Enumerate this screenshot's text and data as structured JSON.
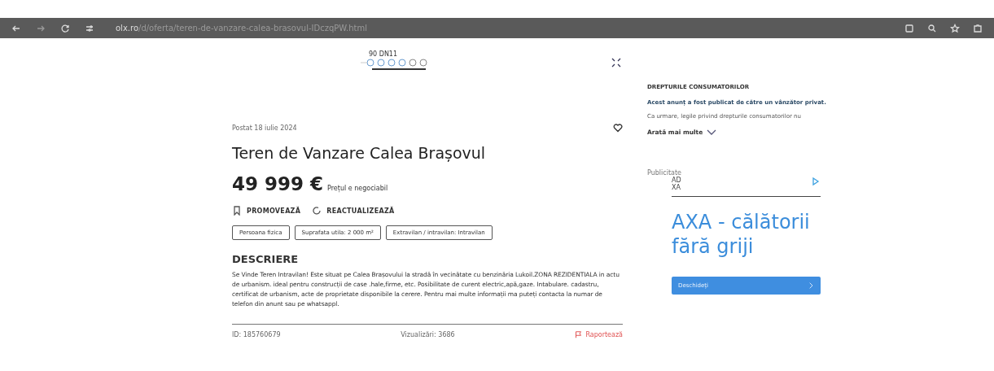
{
  "browser": {
    "url_host": "olx.ro",
    "url_path": "/d/oferta/teren-de-vanzare-calea-brasovul-IDczqPW.html"
  },
  "gallery": {
    "caption": "90 DN11"
  },
  "listing": {
    "posted": "Postat 18 iulie 2024",
    "title": "Teren de Vanzare Calea Brașovul",
    "price": "49 999 €",
    "price_note": "Prețul e negociabil",
    "actions": [
      {
        "kind": "promote",
        "label": "PROMOVEAZĂ"
      },
      {
        "kind": "refresh",
        "label": "REACTUALIZEAZĂ"
      }
    ],
    "tags": [
      "Persoana fizica",
      "Suprafata utila: 2 000 m²",
      "Extravilan / intravilan: Intravilan"
    ],
    "description_heading": "DESCRIERE",
    "description": "Se Vinde Teren Intravilan! Este situat pe Calea Brașovului la stradă în vecinătate cu benzinăria Lukoil.ZONA REZIDENTIALA in actu de urbanism. ideal pentru construcții de case .hale,firme, etc.  Posibilitate de curent electric,apă,gaze. Intabulare. cadastru, certificat de urbanism, acte de proprietate disponibile la cerere. Pentru mai multe informații ma puteți contacta la numar de telefon din anunt sau pe whatsappl.",
    "id": "ID: 185760679",
    "views": "Vizualizări: 3686",
    "report": "Raportează"
  },
  "consumer": {
    "heading": "DREPTURILE CONSUMATORILOR",
    "lead": "Acest anunț a fost publicat de către un vânzător privat.",
    "text": "Ca urmare, legile privind drepturile consumatorilor nu",
    "more": "Arată mai multe"
  },
  "ad": {
    "label": "Publicitate",
    "advertiser_top": "AD",
    "advertiser_bottom": "XA",
    "headline": "AXA - călătorii fără griji",
    "button": "Deschideți"
  }
}
